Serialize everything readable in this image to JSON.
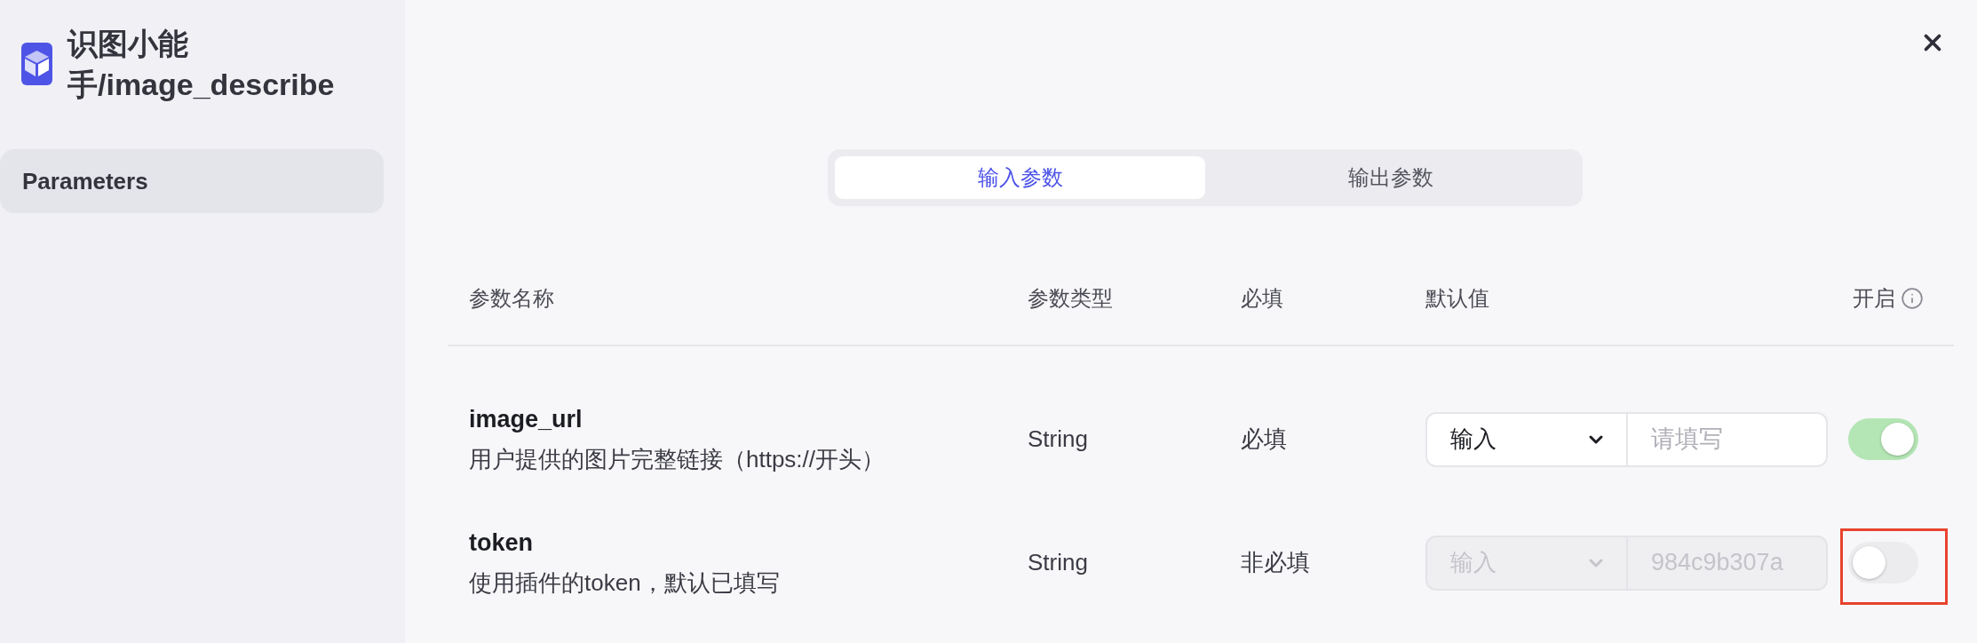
{
  "sidebar": {
    "title": "识图小能手/image_describe",
    "items": [
      {
        "label": "Parameters",
        "selected": true
      }
    ]
  },
  "tabs": [
    {
      "label": "输入参数",
      "selected": true
    },
    {
      "label": "输出参数",
      "selected": false
    }
  ],
  "table": {
    "columns": [
      "参数名称",
      "参数类型",
      "必填",
      "默认值",
      "开启"
    ],
    "rows": [
      {
        "name": "image_url",
        "description": "用户提供的图片完整链接（https://开头）",
        "type": "String",
        "required": "必填",
        "default_source": "输入",
        "default_value": {
          "placeholder": "请填写"
        },
        "disabled": false,
        "on": true,
        "highlighted": false
      },
      {
        "name": "token",
        "description": "使用插件的token，默认已填写",
        "type": "String",
        "required": "非必填",
        "default_source": "输入",
        "default_value": {
          "value": "984c9b307a"
        },
        "disabled": true,
        "on": false,
        "highlighted": true
      }
    ]
  }
}
